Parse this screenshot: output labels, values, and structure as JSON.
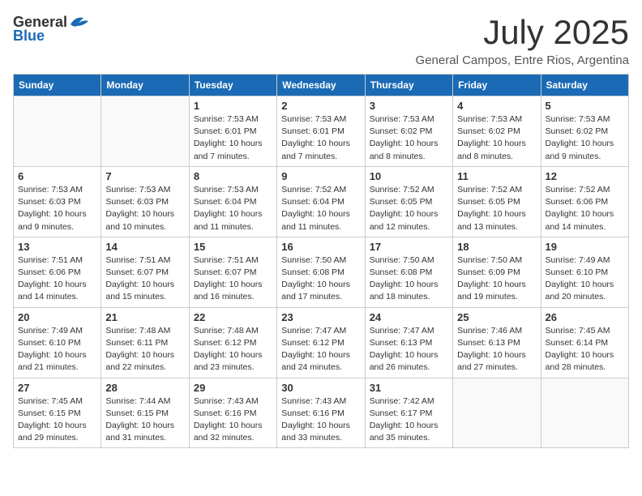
{
  "header": {
    "logo_general": "General",
    "logo_blue": "Blue",
    "month": "July 2025",
    "location": "General Campos, Entre Rios, Argentina"
  },
  "weekdays": [
    "Sunday",
    "Monday",
    "Tuesday",
    "Wednesday",
    "Thursday",
    "Friday",
    "Saturday"
  ],
  "weeks": [
    [
      {
        "day": "",
        "info": ""
      },
      {
        "day": "",
        "info": ""
      },
      {
        "day": "1",
        "info": "Sunrise: 7:53 AM\nSunset: 6:01 PM\nDaylight: 10 hours and 7 minutes."
      },
      {
        "day": "2",
        "info": "Sunrise: 7:53 AM\nSunset: 6:01 PM\nDaylight: 10 hours and 7 minutes."
      },
      {
        "day": "3",
        "info": "Sunrise: 7:53 AM\nSunset: 6:02 PM\nDaylight: 10 hours and 8 minutes."
      },
      {
        "day": "4",
        "info": "Sunrise: 7:53 AM\nSunset: 6:02 PM\nDaylight: 10 hours and 8 minutes."
      },
      {
        "day": "5",
        "info": "Sunrise: 7:53 AM\nSunset: 6:02 PM\nDaylight: 10 hours and 9 minutes."
      }
    ],
    [
      {
        "day": "6",
        "info": "Sunrise: 7:53 AM\nSunset: 6:03 PM\nDaylight: 10 hours and 9 minutes."
      },
      {
        "day": "7",
        "info": "Sunrise: 7:53 AM\nSunset: 6:03 PM\nDaylight: 10 hours and 10 minutes."
      },
      {
        "day": "8",
        "info": "Sunrise: 7:53 AM\nSunset: 6:04 PM\nDaylight: 10 hours and 11 minutes."
      },
      {
        "day": "9",
        "info": "Sunrise: 7:52 AM\nSunset: 6:04 PM\nDaylight: 10 hours and 11 minutes."
      },
      {
        "day": "10",
        "info": "Sunrise: 7:52 AM\nSunset: 6:05 PM\nDaylight: 10 hours and 12 minutes."
      },
      {
        "day": "11",
        "info": "Sunrise: 7:52 AM\nSunset: 6:05 PM\nDaylight: 10 hours and 13 minutes."
      },
      {
        "day": "12",
        "info": "Sunrise: 7:52 AM\nSunset: 6:06 PM\nDaylight: 10 hours and 14 minutes."
      }
    ],
    [
      {
        "day": "13",
        "info": "Sunrise: 7:51 AM\nSunset: 6:06 PM\nDaylight: 10 hours and 14 minutes."
      },
      {
        "day": "14",
        "info": "Sunrise: 7:51 AM\nSunset: 6:07 PM\nDaylight: 10 hours and 15 minutes."
      },
      {
        "day": "15",
        "info": "Sunrise: 7:51 AM\nSunset: 6:07 PM\nDaylight: 10 hours and 16 minutes."
      },
      {
        "day": "16",
        "info": "Sunrise: 7:50 AM\nSunset: 6:08 PM\nDaylight: 10 hours and 17 minutes."
      },
      {
        "day": "17",
        "info": "Sunrise: 7:50 AM\nSunset: 6:08 PM\nDaylight: 10 hours and 18 minutes."
      },
      {
        "day": "18",
        "info": "Sunrise: 7:50 AM\nSunset: 6:09 PM\nDaylight: 10 hours and 19 minutes."
      },
      {
        "day": "19",
        "info": "Sunrise: 7:49 AM\nSunset: 6:10 PM\nDaylight: 10 hours and 20 minutes."
      }
    ],
    [
      {
        "day": "20",
        "info": "Sunrise: 7:49 AM\nSunset: 6:10 PM\nDaylight: 10 hours and 21 minutes."
      },
      {
        "day": "21",
        "info": "Sunrise: 7:48 AM\nSunset: 6:11 PM\nDaylight: 10 hours and 22 minutes."
      },
      {
        "day": "22",
        "info": "Sunrise: 7:48 AM\nSunset: 6:12 PM\nDaylight: 10 hours and 23 minutes."
      },
      {
        "day": "23",
        "info": "Sunrise: 7:47 AM\nSunset: 6:12 PM\nDaylight: 10 hours and 24 minutes."
      },
      {
        "day": "24",
        "info": "Sunrise: 7:47 AM\nSunset: 6:13 PM\nDaylight: 10 hours and 26 minutes."
      },
      {
        "day": "25",
        "info": "Sunrise: 7:46 AM\nSunset: 6:13 PM\nDaylight: 10 hours and 27 minutes."
      },
      {
        "day": "26",
        "info": "Sunrise: 7:45 AM\nSunset: 6:14 PM\nDaylight: 10 hours and 28 minutes."
      }
    ],
    [
      {
        "day": "27",
        "info": "Sunrise: 7:45 AM\nSunset: 6:15 PM\nDaylight: 10 hours and 29 minutes."
      },
      {
        "day": "28",
        "info": "Sunrise: 7:44 AM\nSunset: 6:15 PM\nDaylight: 10 hours and 31 minutes."
      },
      {
        "day": "29",
        "info": "Sunrise: 7:43 AM\nSunset: 6:16 PM\nDaylight: 10 hours and 32 minutes."
      },
      {
        "day": "30",
        "info": "Sunrise: 7:43 AM\nSunset: 6:16 PM\nDaylight: 10 hours and 33 minutes."
      },
      {
        "day": "31",
        "info": "Sunrise: 7:42 AM\nSunset: 6:17 PM\nDaylight: 10 hours and 35 minutes."
      },
      {
        "day": "",
        "info": ""
      },
      {
        "day": "",
        "info": ""
      }
    ]
  ]
}
